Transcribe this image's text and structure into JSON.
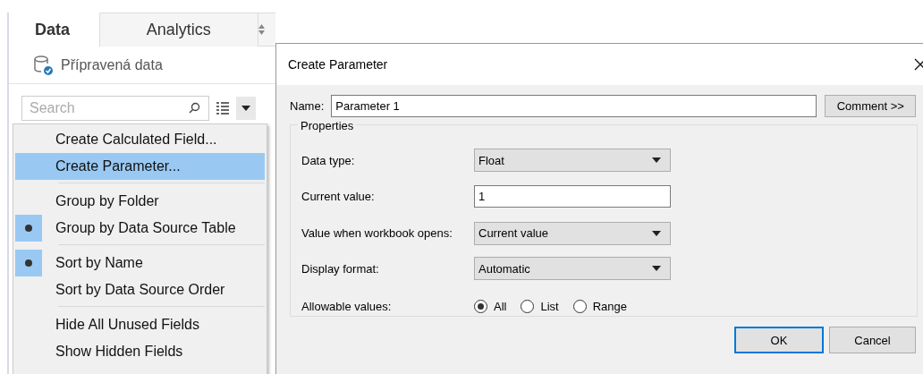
{
  "panel": {
    "tabs": [
      {
        "label": "Data",
        "selected": true
      },
      {
        "label": "Analytics",
        "selected": false
      }
    ],
    "data_source": "Přípravená data",
    "search": {
      "placeholder": "Search"
    }
  },
  "menu": {
    "sections": [
      [
        {
          "label": "Create Calculated Field...",
          "checked": false,
          "selected": false
        },
        {
          "label": "Create Parameter...",
          "checked": false,
          "selected": true
        }
      ],
      [
        {
          "label": "Group by Folder",
          "checked": false,
          "selected": false
        },
        {
          "label": "Group by Data Source Table",
          "checked": true,
          "selected": false
        }
      ],
      [
        {
          "label": "Sort by Name",
          "checked": true,
          "selected": false
        },
        {
          "label": "Sort by Data Source Order",
          "checked": false,
          "selected": false
        }
      ],
      [
        {
          "label": "Hide All Unused Fields",
          "checked": false,
          "selected": false
        },
        {
          "label": "Show Hidden Fields",
          "checked": false,
          "selected": false
        }
      ]
    ]
  },
  "dialog": {
    "title": "Create Parameter",
    "name_label": "Name:",
    "name_value": "Parameter 1",
    "comment_button": "Comment >>",
    "group_title": "Properties",
    "rows": [
      {
        "kind": "select",
        "label": "Data type:",
        "value": "Float"
      },
      {
        "kind": "input",
        "label": "Current value:",
        "value": "1"
      },
      {
        "kind": "select",
        "label": "Value when workbook opens:",
        "value": "Current value"
      },
      {
        "kind": "select",
        "label": "Display format:",
        "value": "Automatic"
      },
      {
        "kind": "radios",
        "label": "Allowable values:",
        "options": [
          {
            "label": "All",
            "selected": true
          },
          {
            "label": "List",
            "selected": false
          },
          {
            "label": "Range",
            "selected": false
          }
        ]
      }
    ],
    "buttons": [
      {
        "label": "OK",
        "default": true
      },
      {
        "label": "Cancel",
        "default": false
      }
    ]
  }
}
